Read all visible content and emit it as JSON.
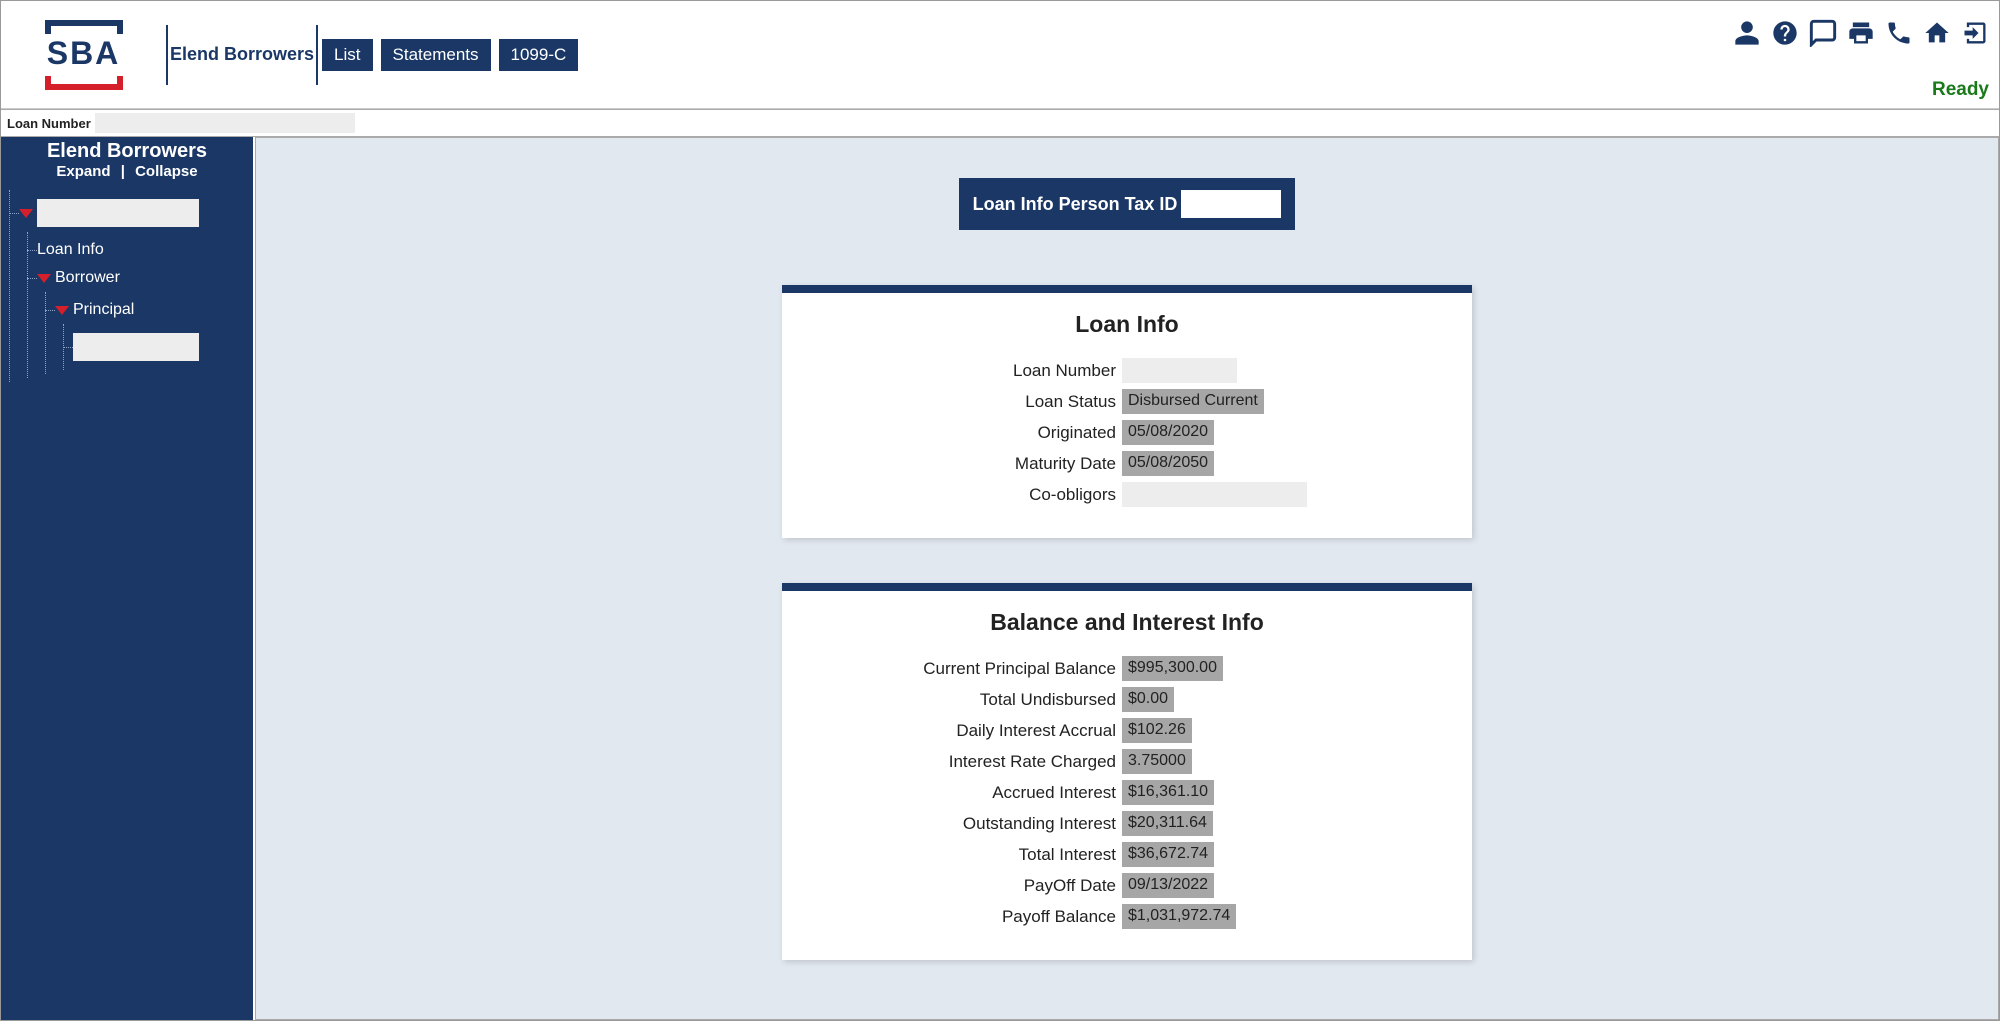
{
  "header": {
    "nav_title": "Elend Borrowers",
    "buttons": {
      "list": "List",
      "statements": "Statements",
      "form1099c": "1099-C"
    },
    "status": "Ready",
    "logo_text": "SBA"
  },
  "subheader": {
    "label": "Loan Number"
  },
  "sidebar": {
    "title": "Elend Borrowers",
    "expand": "Expand",
    "separator": "|",
    "collapse": "Collapse",
    "items": {
      "loan_info": "Loan Info",
      "borrower": "Borrower",
      "principal": "Principal"
    }
  },
  "banner": {
    "label": "Loan Info Person Tax ID"
  },
  "loan_info": {
    "title": "Loan Info",
    "labels": {
      "loan_number": "Loan Number",
      "loan_status": "Loan Status",
      "originated": "Originated",
      "maturity_date": "Maturity Date",
      "co_obligors": "Co-obligors"
    },
    "values": {
      "loan_status": "Disbursed Current",
      "originated": "05/08/2020",
      "maturity_date": "05/08/2050"
    }
  },
  "balance_info": {
    "title": "Balance and Interest Info",
    "labels": {
      "current_principal": "Current Principal Balance",
      "total_undisbursed": "Total Undisbursed",
      "daily_interest": "Daily Interest Accrual",
      "rate_charged": "Interest Rate Charged",
      "accrued_interest": "Accrued Interest",
      "outstanding_interest": "Outstanding Interest",
      "total_interest": "Total Interest",
      "payoff_date": "PayOff Date",
      "payoff_balance": "Payoff Balance"
    },
    "values": {
      "current_principal": "$995,300.00",
      "total_undisbursed": "$0.00",
      "daily_interest": "$102.26",
      "rate_charged": "3.75000",
      "accrued_interest": "$16,361.10",
      "outstanding_interest": "$20,311.64",
      "total_interest": "$36,672.74",
      "payoff_date": "09/13/2022",
      "payoff_balance": "$1,031,972.74"
    }
  }
}
